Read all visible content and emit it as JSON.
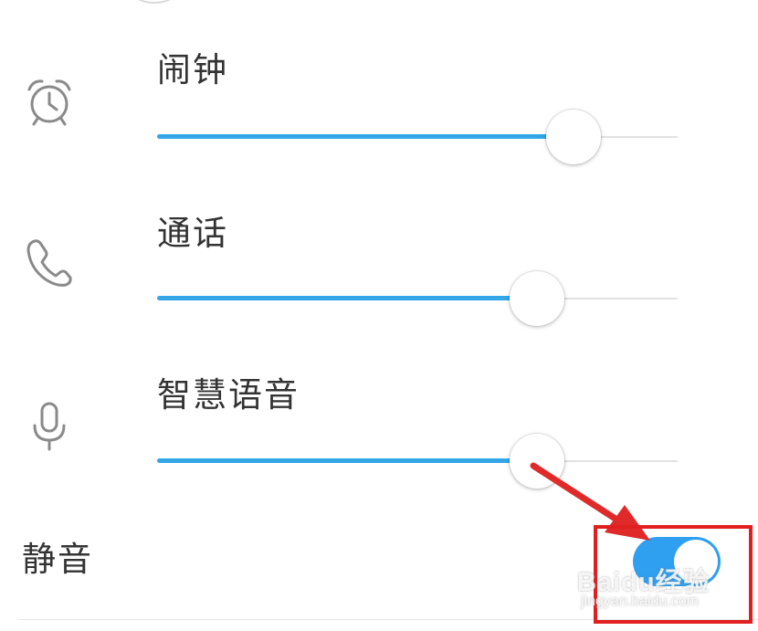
{
  "volume_rows": [
    {
      "label": "闹钟",
      "icon": "alarm-clock-icon",
      "level": 0.8
    },
    {
      "label": "通话",
      "icon": "phone-icon",
      "level": 0.73
    },
    {
      "label": "智慧语音",
      "icon": "microphone-icon",
      "level": 0.73
    }
  ],
  "mute": {
    "label": "静音",
    "on": true
  },
  "colors": {
    "accent": "#33a6e8",
    "toggle_on": "#2f9ff0",
    "annotation_red": "#e02020"
  },
  "watermark": {
    "main": "Baidu经验",
    "sub": "jingyan.baidu.com"
  }
}
